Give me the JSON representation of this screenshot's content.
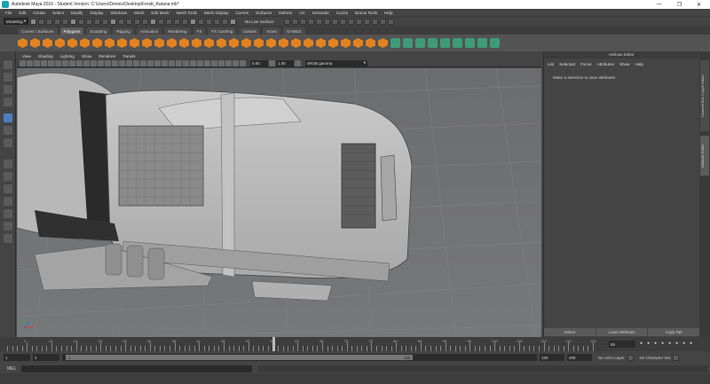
{
  "window": {
    "title": "Autodesk Maya 2016 - Student Version: C:\\Users\\Dennis\\Desktop\\Fendt_Katana.mb*",
    "minimize": "—",
    "maximize": "❐",
    "close": "✕"
  },
  "menubar": [
    "File",
    "Edit",
    "Create",
    "Select",
    "Modify",
    "Display",
    "Windows",
    "Mesh",
    "Edit Mesh",
    "Mesh Tools",
    "Mesh Display",
    "Curves",
    "Surfaces",
    "Deform",
    "UV",
    "Generate",
    "Cache",
    "Bonus Tools",
    "Help"
  ],
  "status": {
    "mode": "Modeling",
    "live_surface": "No Live Surface"
  },
  "shelf_tabs": [
    "Curves / Surfaces",
    "Polygons",
    "Sculpting",
    "Rigging",
    "Animation",
    "Rendering",
    "FX",
    "FX Caching",
    "Custom",
    "XGen",
    "GAMES"
  ],
  "active_shelf": "Polygons",
  "viewport_menu": [
    "View",
    "Shading",
    "Lighting",
    "Show",
    "Renderer",
    "Panels"
  ],
  "viewport_toolbar": {
    "exposure": "0.00",
    "gamma": "1.00",
    "color_space": "sRGB gamma"
  },
  "attribute_editor": {
    "title": "Attribute Editor",
    "menu": [
      "List",
      "Selected",
      "Focus",
      "Attributes",
      "Show",
      "Help"
    ],
    "message": "Make a selection to view attributes",
    "buttons": [
      "Select",
      "Load Attributes",
      "Copy Tab"
    ]
  },
  "side_tabs": [
    "Channel Box / Layer Editor",
    "Attribute Editor"
  ],
  "timeline": {
    "ticks": [
      "5",
      "10",
      "15",
      "20",
      "25",
      "30",
      "35",
      "40",
      "45",
      "50",
      "55",
      "60",
      "65",
      "70",
      "75",
      "80",
      "85",
      "90",
      "95",
      "100",
      "105",
      "110",
      "115",
      "120"
    ],
    "current_frame": "55"
  },
  "range": {
    "start": "1",
    "inner_start": "1",
    "slider_start": "1",
    "slider_end": "120",
    "end": "120",
    "anim_end": "200",
    "anim_layer": "No Anim Layer",
    "char_set": "No Character Set"
  },
  "cmdline": {
    "label": "MEL"
  },
  "colors": {
    "accent": "#4a7fc0",
    "shelf_orange": "#e4821f",
    "viewport": "#6f7072"
  }
}
